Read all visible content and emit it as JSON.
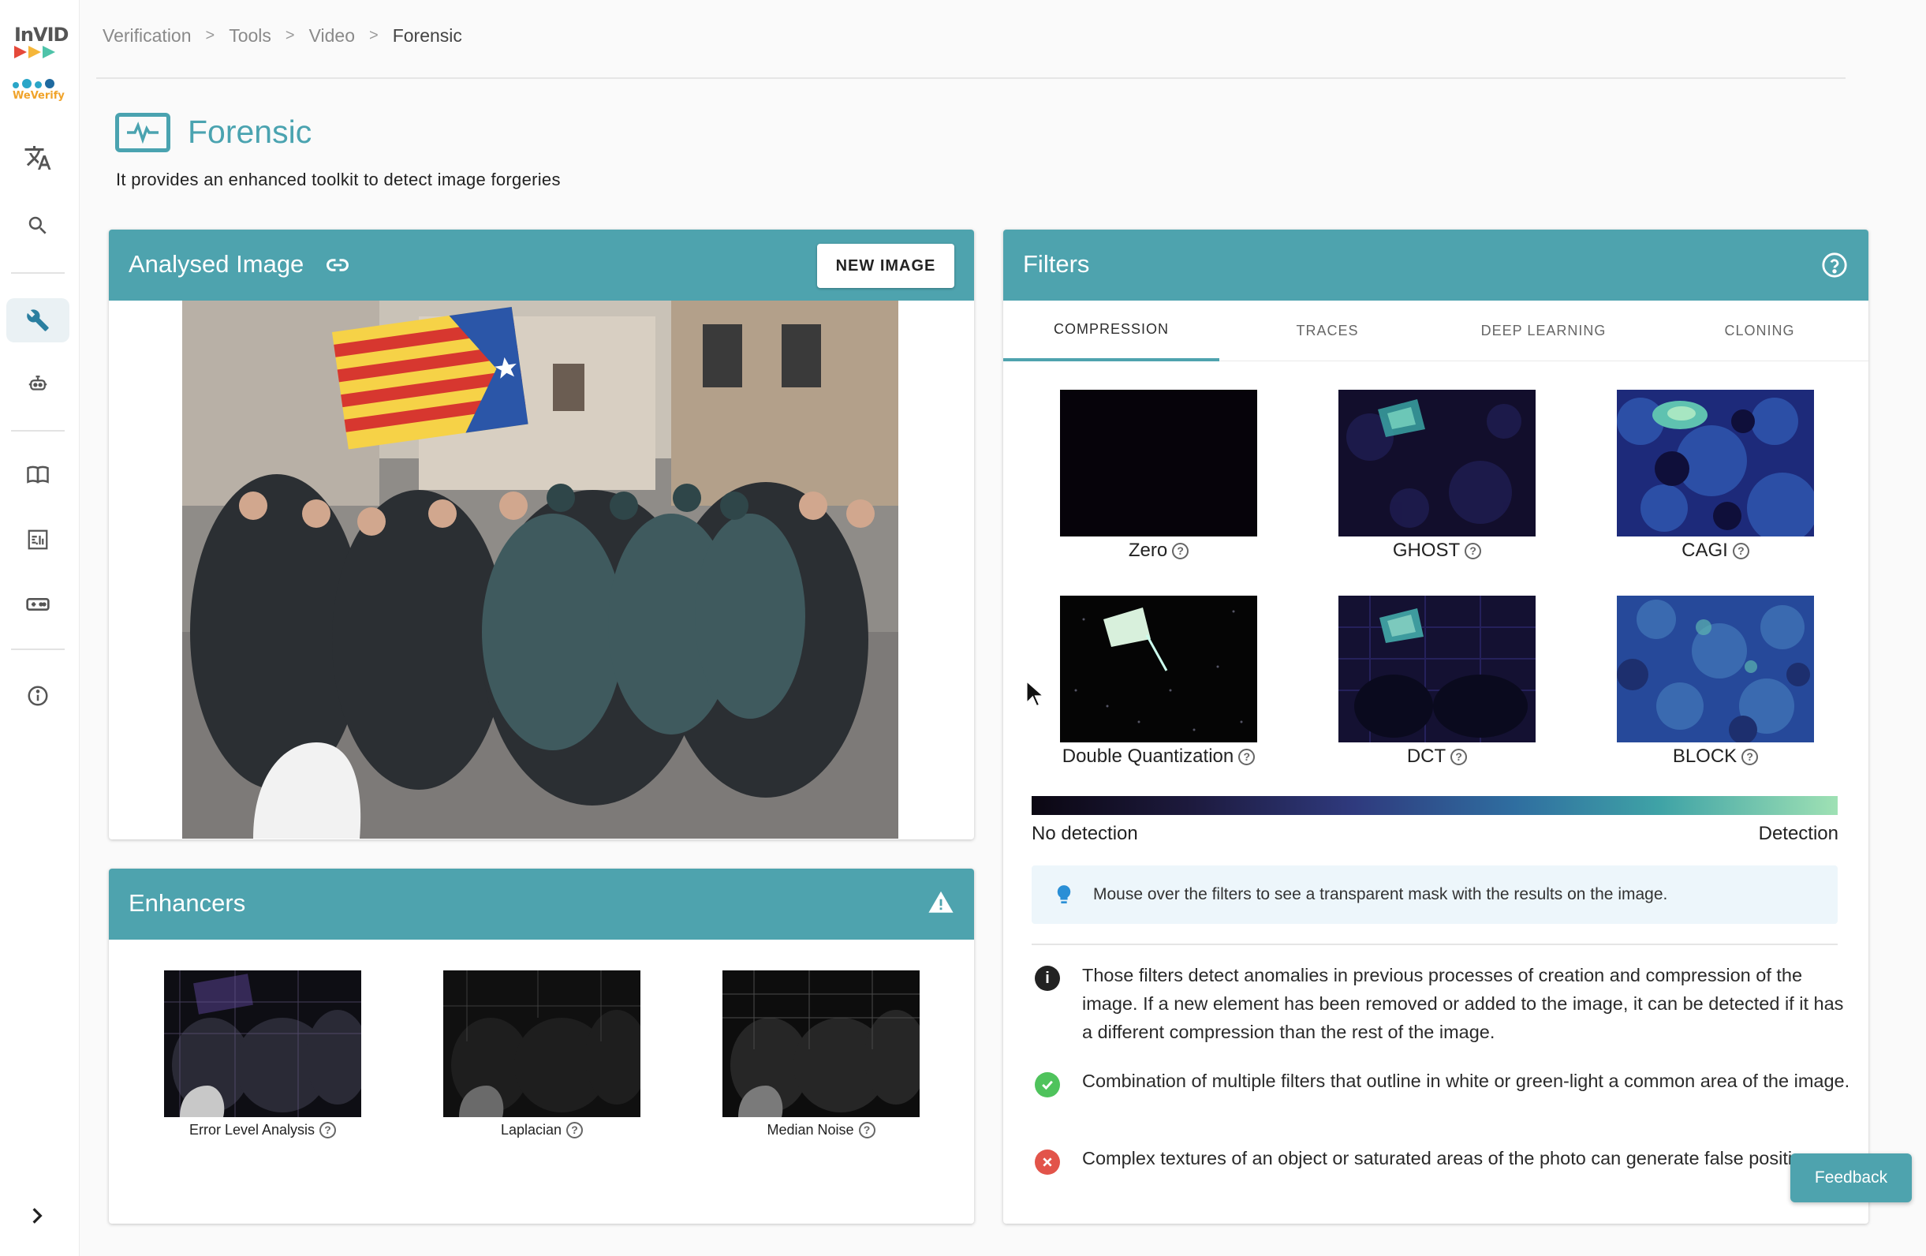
{
  "sidebar": {
    "logo_invid": "InVID",
    "logo_weverify": "WeVerify",
    "icons": [
      "translate-icon",
      "search-icon",
      "wrench-icon",
      "robot-icon",
      "book-icon",
      "dashboard-icon",
      "gamepad-icon",
      "info-icon",
      "chevron-right-icon"
    ],
    "active": "wrench-icon"
  },
  "breadcrumb": [
    "Verification",
    "Tools",
    "Video",
    "Forensic"
  ],
  "header": {
    "title": "Forensic",
    "subtitle": "It provides an enhanced toolkit to detect image forgeries"
  },
  "analysed": {
    "title": "Analysed Image",
    "new_image_button": "NEW IMAGE"
  },
  "enhancers": {
    "title": "Enhancers",
    "items": [
      "Error Level Analysis",
      "Laplacian",
      "Median Noise"
    ]
  },
  "filters": {
    "title": "Filters",
    "tabs": [
      "COMPRESSION",
      "TRACES",
      "DEEP LEARNING",
      "CLONING"
    ],
    "active_tab": "COMPRESSION",
    "tiles": [
      "Zero",
      "GHOST",
      "CAGI",
      "Double Quantization",
      "DCT",
      "BLOCK"
    ],
    "scale_left": "No detection",
    "scale_right": "Detection",
    "hint": "Mouse over the filters to see a transparent mask with the results on the image.",
    "notes": [
      "Those filters detect anomalies in previous processes of creation and compression of the image. If a new element has been removed or added to the image, it can be detected if it has a different compression than the rest of the image.",
      "Combination of multiple filters that outline in white or green-light a common area of the image.",
      "Complex textures of an object or saturated areas of the photo can generate false positives."
    ]
  },
  "feedback_button": "Feedback",
  "colors": {
    "accent": "#4ea3ae",
    "title": "#4aa3b0",
    "success": "#4fc35c",
    "error": "#e2544a"
  }
}
